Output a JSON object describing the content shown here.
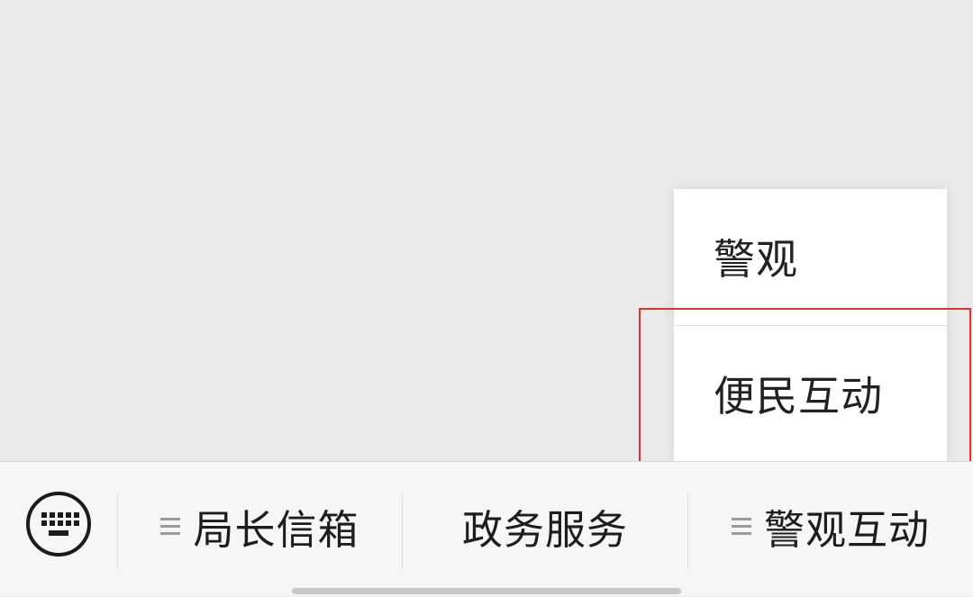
{
  "bottom_menu": {
    "keyboard_icon": "keyboard-icon",
    "tabs": [
      {
        "label": "局长信箱",
        "has_submenu": true
      },
      {
        "label": "政务服务",
        "has_submenu": false
      },
      {
        "label": "警观互动",
        "has_submenu": true
      }
    ]
  },
  "popup_menu": {
    "items": [
      {
        "label": "警观"
      },
      {
        "label": "便民互动"
      }
    ]
  },
  "colors": {
    "highlight": "#e5302b",
    "background": "#ebebeb",
    "bar_background": "#f6f6f6"
  }
}
